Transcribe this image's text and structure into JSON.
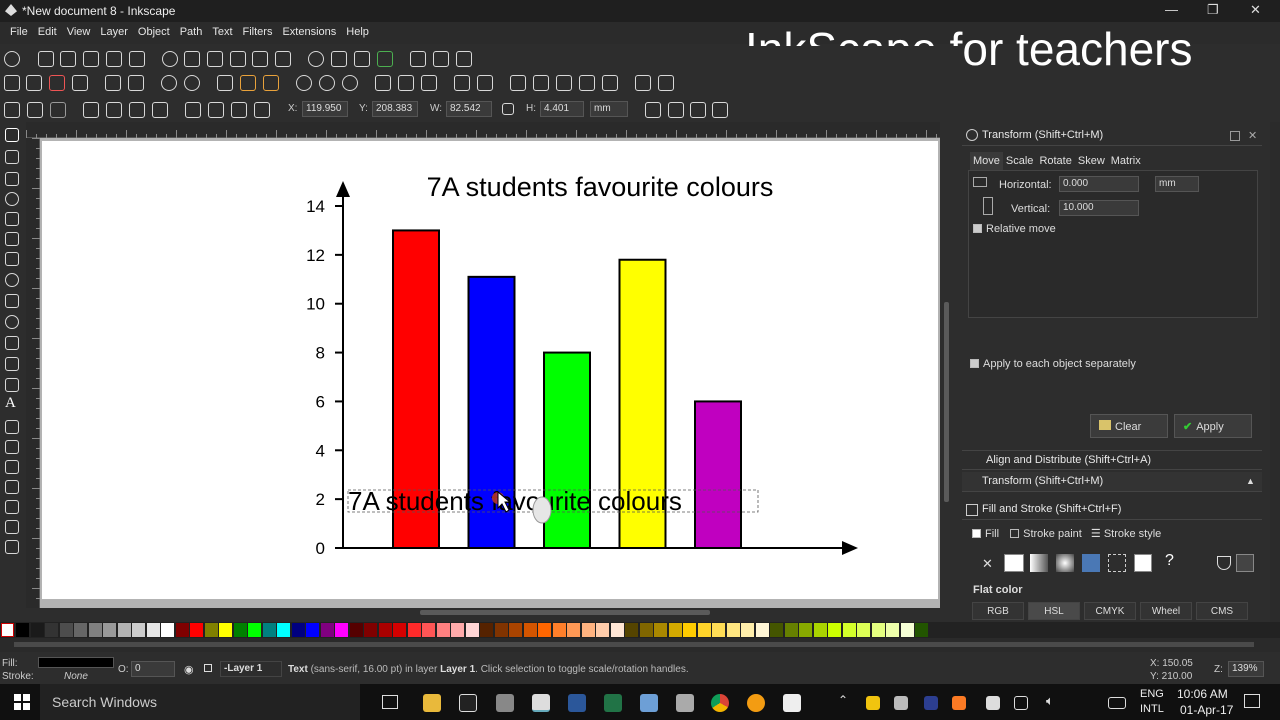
{
  "window": {
    "title": "*New document 8 - Inkscape",
    "min": "—",
    "max": "❐",
    "close": "✕"
  },
  "overlay_title": "InkScape for teachers",
  "menu": [
    "File",
    "Edit",
    "View",
    "Layer",
    "Object",
    "Path",
    "Text",
    "Filters",
    "Extensions",
    "Help"
  ],
  "toolctl": {
    "x_label": "X:",
    "x_value": "119.950",
    "y_label": "Y:",
    "y_value": "208.383",
    "w_label": "W:",
    "w_value": "82.542",
    "h_label": "H:",
    "h_value": "4.401",
    "unit": "mm"
  },
  "chart_data": {
    "type": "bar",
    "title": "7A students favourite colours",
    "categories": [
      "",
      "",
      "",
      "",
      ""
    ],
    "values": [
      13,
      11.1,
      8,
      11.8,
      6
    ],
    "colors": [
      "#ff0000",
      "#0000ff",
      "#00ff00",
      "#ffff00",
      "#c000c0"
    ],
    "yticks": [
      "0",
      "2",
      "4",
      "6",
      "8",
      "10",
      "12",
      "14"
    ],
    "ylim": [
      0,
      14
    ],
    "xlabel": "",
    "ylabel": "",
    "grid": false
  },
  "canvas_text_selected": "7A students favourite colours",
  "panel": {
    "transform_title": "Transform (Shift+Ctrl+M)",
    "tabs": [
      "Move",
      "Scale",
      "Rotate",
      "Skew",
      "Matrix"
    ],
    "horizontal_label": "Horizontal:",
    "horizontal_value": "0.000",
    "vertical_label": "Vertical:",
    "vertical_value": "10.000",
    "unit": "mm",
    "relative_move": "Relative move",
    "apply_each": "Apply to each object separately",
    "clear": "Clear",
    "apply": "Apply",
    "align_title": "Align and Distribute (Shift+Ctrl+A)",
    "transform_title2": "Transform (Shift+Ctrl+M)",
    "fillstroke_title": "Fill and Stroke (Shift+Ctrl+F)",
    "fs_tabs": [
      "Fill",
      "Stroke paint",
      "Stroke style"
    ],
    "flat_color": "Flat color",
    "color_modes": [
      "RGB",
      "HSL",
      "CMYK",
      "Wheel",
      "CMS"
    ]
  },
  "status": {
    "fill_label": "Fill:",
    "stroke_label": "Stroke:",
    "stroke_value": "None",
    "o_label": "O:",
    "o_value": "0",
    "layer": "-Layer 1",
    "message_bold": "Text",
    "message": " (sans-serif, 16.00 pt) in layer ",
    "message_layer": "Layer 1",
    "message_end": ". Click selection to toggle scale/rotation handles.",
    "x_coord": "X: 150.05",
    "y_coord": "Y: 210.00",
    "z_label": "Z:",
    "zoom": "139%"
  },
  "taskbar": {
    "search": "Search Windows",
    "lang1": "ENG",
    "lang2": "INTL",
    "time": "10:06 AM",
    "date": "01-Apr-17"
  },
  "palette": [
    "#000000",
    "#1a1a1a",
    "#333333",
    "#4d4d4d",
    "#666666",
    "#808080",
    "#999999",
    "#b3b3b3",
    "#cccccc",
    "#e6e6e6",
    "#ffffff",
    "#800000",
    "#ff0000",
    "#808000",
    "#ffff00",
    "#008000",
    "#00ff00",
    "#008080",
    "#00ffff",
    "#000080",
    "#0000ff",
    "#800080",
    "#ff00ff",
    "#550000",
    "#800000",
    "#aa0000",
    "#d40000",
    "#ff2a2a",
    "#ff5555",
    "#ff8080",
    "#ffaaaa",
    "#ffd5d5",
    "#552200",
    "#803300",
    "#aa4400",
    "#d45500",
    "#ff6600",
    "#ff7f2a",
    "#ff9955",
    "#ffb380",
    "#ffccaa",
    "#ffe6d5",
    "#554400",
    "#806600",
    "#aa8800",
    "#d4aa00",
    "#ffcc00",
    "#ffd42a",
    "#ffdd55",
    "#ffe680",
    "#ffeeaa",
    "#fff6d5",
    "#445500",
    "#668000",
    "#88aa00",
    "#aad400",
    "#ccff00",
    "#d4ff2a",
    "#ddff55",
    "#e5ff80",
    "#eeffaa",
    "#f6ffd5",
    "#225500"
  ]
}
